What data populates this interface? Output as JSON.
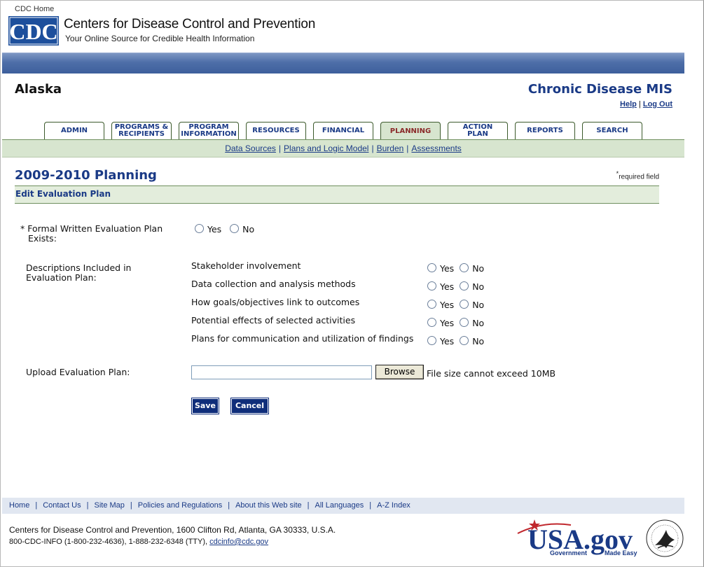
{
  "header": {
    "cdc_home": "CDC Home",
    "logo_text": "CDC",
    "org_name": "Centers for Disease Control and Prevention",
    "tagline": "Your Online Source for Credible Health Information"
  },
  "app": {
    "state": "Alaska",
    "title": "Chronic Disease MIS",
    "help": "Help",
    "separator": "|",
    "logout": "Log Out"
  },
  "tabs": [
    {
      "line1": "ADMIN",
      "line2": ""
    },
    {
      "line1": "PROGRAMS &",
      "line2": "RECIPIENTS"
    },
    {
      "line1": "PROGRAM",
      "line2": "INFORMATION"
    },
    {
      "line1": "RESOURCES",
      "line2": ""
    },
    {
      "line1": "FINANCIAL",
      "line2": ""
    },
    {
      "line1": "PLANNING",
      "line2": "",
      "active": true
    },
    {
      "line1": "ACTION",
      "line2": "PLAN"
    },
    {
      "line1": "REPORTS",
      "line2": ""
    },
    {
      "line1": "SEARCH",
      "line2": ""
    }
  ],
  "subnav": [
    "Data Sources",
    "Plans and Logic Model",
    "Burden",
    "Assessments"
  ],
  "page": {
    "title": "2009-2010 Planning",
    "required_star": "*",
    "required_text": "required field",
    "section": "Edit Evaluation Plan"
  },
  "form": {
    "plan_exists_label_1": "* Formal Written Evaluation Plan",
    "plan_exists_label_2": "Exists:",
    "descriptions_label_1": "Descriptions Included in",
    "descriptions_label_2": "Evaluation Plan:",
    "yes": "Yes",
    "no": "No",
    "items": [
      "Stakeholder involvement",
      "Data collection and analysis methods",
      "How goals/objectives link to outcomes",
      "Potential effects of selected activities",
      "Plans for communication and utilization of findings"
    ],
    "upload_label": "Upload Evaluation Plan:",
    "browse": "Browse",
    "file_note": "File size cannot exceed 10MB",
    "save": "Save",
    "cancel": "Cancel"
  },
  "footer": {
    "links": [
      "Home",
      "Contact Us",
      "Site Map",
      "Policies and Regulations",
      "About this Web site",
      "All Languages",
      "A-Z Index"
    ],
    "address": "Centers for Disease Control and Prevention, 1600 Clifton Rd, Atlanta, GA 30333, U.S.A.",
    "phone": "800-CDC-INFO (1-800-232-4636), 1-888-232-6348 (TTY), ",
    "email": "cdcinfo@cdc.gov",
    "usa_logo": "USA.gov",
    "usa_sub_1": "Government",
    "usa_sub_2": "Made Easy"
  },
  "colors": {
    "brand_blue": "#1a3a86",
    "nav_green": "#d7e5cf",
    "active_tab_text": "#8b2a2a"
  }
}
